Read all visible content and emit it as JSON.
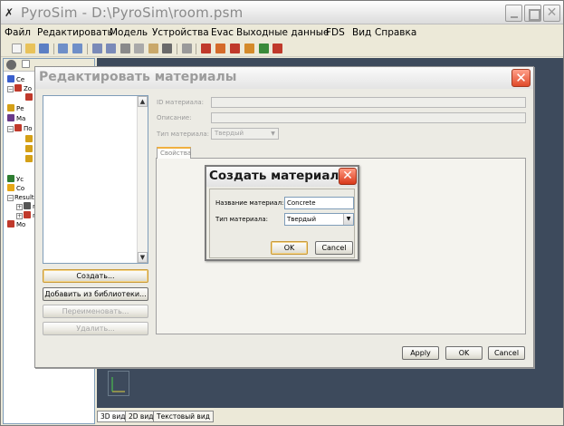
{
  "app": {
    "title": "PyroSim - D:\\PyroSim\\room.psm"
  },
  "menu": [
    "Файл",
    "Редактировать",
    "Модель",
    "Устройства",
    "Evac",
    "Выходные данные",
    "FDS",
    "Вид",
    "Справка"
  ],
  "tree": {
    "items": [
      {
        "label": "Се",
        "color": "#3a5fcd"
      },
      {
        "label": "Zo",
        "color": "#c0392b"
      },
      {
        "label": "",
        "color": "#c0392b"
      },
      {
        "label": "Ре",
        "color": "#d4a017"
      },
      {
        "label": "Ма",
        "color": "#6a3a8a"
      },
      {
        "label": "По",
        "color": "#c0392b"
      },
      {
        "label": "",
        "color": "#d4a017"
      },
      {
        "label": "",
        "color": "#d4a017"
      },
      {
        "label": "",
        "color": "#d4a017"
      },
      {
        "label": "Ус",
        "color": "#2e7d32"
      },
      {
        "label": "Co",
        "color": "#e6a817"
      },
      {
        "label": "Result",
        "color": ""
      },
      {
        "label": "r2",
        "color": "#555555"
      },
      {
        "label": "n",
        "color": "#c0392b"
      },
      {
        "label": "Mo",
        "color": "#c0392b"
      }
    ]
  },
  "view_tabs": [
    "3D вид",
    "2D вид",
    "Текстовый вид"
  ],
  "edit_dialog": {
    "title": "Редактировать материалы",
    "labels": {
      "id": "ID материала:",
      "description": "Описание:",
      "type": "Тип материала:"
    },
    "type_value": "Твердый",
    "tab": "Свойства",
    "buttons": {
      "create": "Создать...",
      "add_from_library": "Добавить из библиотеки...",
      "rename": "Переименовать...",
      "delete": "Удалить...",
      "apply": "Apply",
      "ok": "OK",
      "cancel": "Cancel"
    }
  },
  "create_dialog": {
    "title": "Создать материал",
    "name_label": "Название материал:",
    "name_value": "Concrete",
    "type_label": "Тип материала:",
    "type_value": "Твердый",
    "ok": "OK",
    "cancel": "Cancel"
  }
}
